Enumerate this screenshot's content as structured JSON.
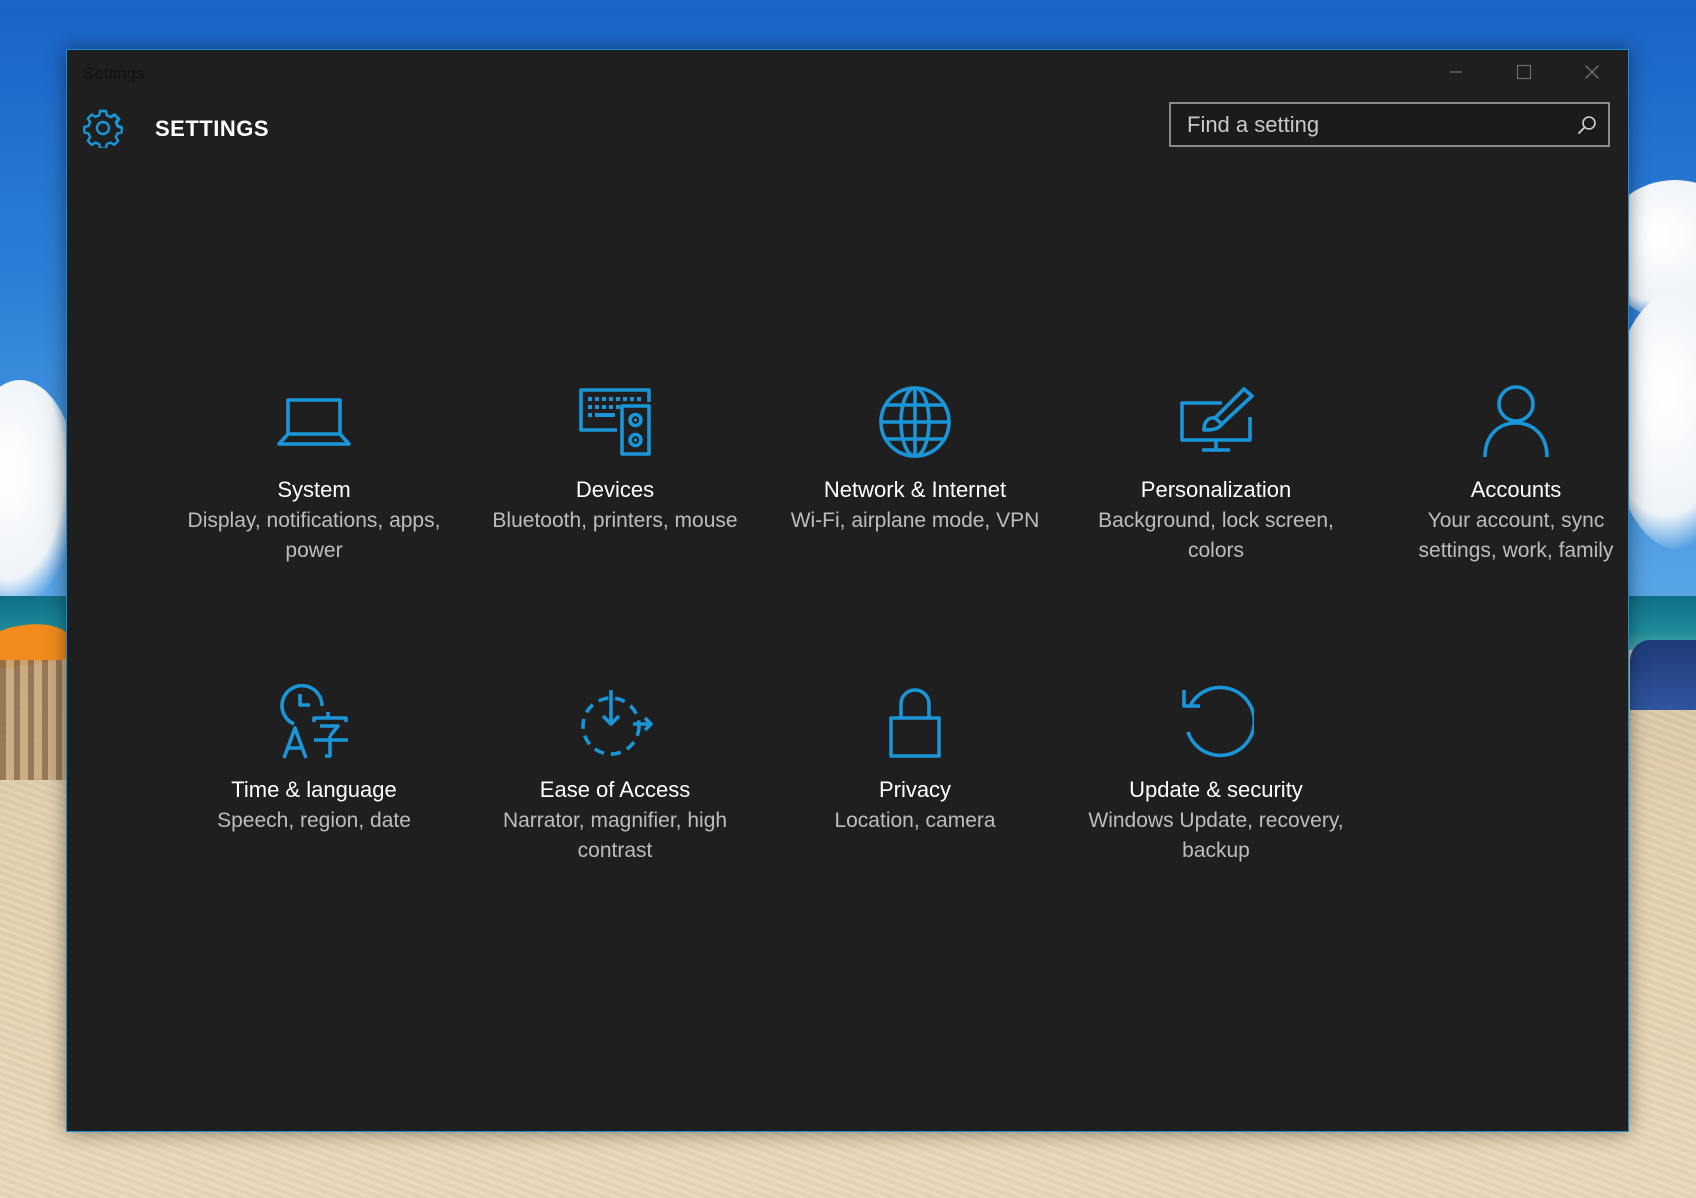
{
  "window": {
    "title": "Settings",
    "accent_color": "#1a95d8",
    "background_color": "#1f1f1f"
  },
  "header": {
    "app_title": "SETTINGS",
    "icon": "gear-icon"
  },
  "search": {
    "placeholder": "Find a setting",
    "value": "",
    "icon": "search-icon"
  },
  "caption_buttons": [
    "minimize",
    "maximize",
    "close"
  ],
  "categories": [
    {
      "id": "system",
      "name": "System",
      "description": "Display, notifications, apps, power",
      "icon": "laptop-icon"
    },
    {
      "id": "devices",
      "name": "Devices",
      "description": "Bluetooth, printers, mouse",
      "icon": "keyboard-speaker-icon"
    },
    {
      "id": "network",
      "name": "Network & Internet",
      "description": "Wi-Fi, airplane mode, VPN",
      "icon": "globe-icon"
    },
    {
      "id": "personalization",
      "name": "Personalization",
      "description": "Background, lock screen, colors",
      "icon": "monitor-brush-icon"
    },
    {
      "id": "accounts",
      "name": "Accounts",
      "description": "Your account, sync settings, work, family",
      "icon": "person-icon"
    },
    {
      "id": "time-language",
      "name": "Time & language",
      "description": "Speech, region, date",
      "icon": "clock-language-icon"
    },
    {
      "id": "ease-of-access",
      "name": "Ease of Access",
      "description": "Narrator, magnifier, high contrast",
      "icon": "ease-of-access-icon"
    },
    {
      "id": "privacy",
      "name": "Privacy",
      "description": "Location, camera",
      "icon": "lock-icon"
    },
    {
      "id": "update-security",
      "name": "Update & security",
      "description": "Windows Update, recovery, backup",
      "icon": "refresh-icon"
    }
  ]
}
